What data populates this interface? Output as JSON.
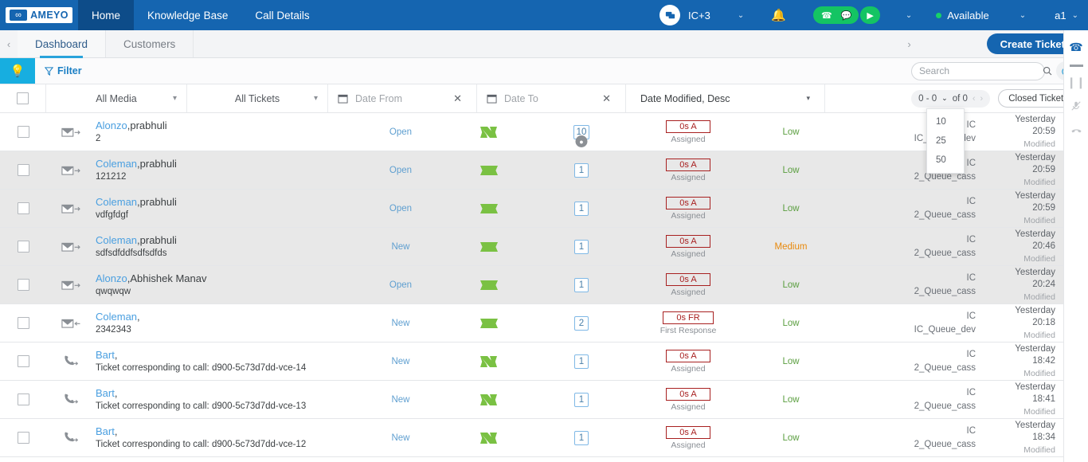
{
  "topnav": {
    "brand": "AMEYO",
    "brand_icon": "infinity-icon",
    "items": [
      {
        "label": "Home",
        "active": true
      },
      {
        "label": "Knowledge Base",
        "active": false
      },
      {
        "label": "Call Details",
        "active": false
      }
    ],
    "ic_label": "IC+3",
    "ic_icon": "chat-bubble-icon",
    "ic_chevron": "⌄",
    "bell_icon": "bell-icon",
    "phone_icon": "phone-icon",
    "chat_icon": "chat-icon",
    "video_icon": "video-icon",
    "channel_chevron": "⌄",
    "status_label": "Available",
    "status_color": "#17d268",
    "status_chevron": "⌄",
    "user_label": "a1",
    "user_chevron": "⌄"
  },
  "tabstrip": {
    "prev_arrow": "‹",
    "next_arrow": "›",
    "tabs": [
      {
        "label": "Dashboard",
        "active": true
      },
      {
        "label": "Customers",
        "active": false
      }
    ],
    "create_ticket_label": "Create Ticket"
  },
  "filterbar": {
    "bulb_icon": "lightbulb-icon",
    "filter_icon": "funnel-icon",
    "filter_label": "Filter",
    "search_placeholder": "Search",
    "search_value": "",
    "search_icon": "search-icon",
    "refresh_icon": "refresh-icon"
  },
  "toolbar": {
    "select_all_checked": false,
    "media_filter": "All Media",
    "tickets_filter": "All Tickets",
    "date_from_placeholder": "Date From",
    "date_from_value": "",
    "date_to_placeholder": "Date To",
    "date_to_value": "",
    "clear_icon": "close-icon",
    "calendar_icon": "calendar-icon",
    "sort_label": "Date Modified, Desc",
    "sort_caret": "▾",
    "pager_range": "0 - 0",
    "pager_caret": "⌄",
    "pager_of": "of 0",
    "pager_prev": "‹",
    "pager_next": "›",
    "closed_tickets_label": "Closed Tickets"
  },
  "page_size_menu": {
    "open": true,
    "options": [
      "10",
      "25",
      "50"
    ]
  },
  "table": {
    "rows": [
      {
        "channel_icon": "email-outbound-icon",
        "customer_first": "Alonzo",
        "customer_rest": ",prabhuli",
        "subject": "2",
        "status": "Open",
        "tag_icon": "tag-split-icon",
        "count": "10",
        "attachment_icon": "pdf-icon",
        "has_attachment": true,
        "sla_badge": "0s A",
        "sla_sub": "Assigned",
        "priority": "Low",
        "priority_level": "low",
        "queue_line1": "IC",
        "queue_line2": "IC_Queue_dev",
        "time_day": "Yesterday",
        "time_clock": "20:59",
        "time_label": "Modified",
        "shaded": false
      },
      {
        "channel_icon": "email-outbound-icon",
        "customer_first": "Coleman",
        "customer_rest": ",prabhuli",
        "subject": "121212",
        "status": "Open",
        "tag_icon": "tag-icon",
        "count": "1",
        "has_attachment": false,
        "sla_badge": "0s A",
        "sla_sub": "Assigned",
        "priority": "Low",
        "priority_level": "low",
        "queue_line1": "IC",
        "queue_line2": "2_Queue_cass",
        "time_day": "Yesterday",
        "time_clock": "20:59",
        "time_label": "Modified",
        "shaded": true
      },
      {
        "channel_icon": "email-outbound-icon",
        "customer_first": "Coleman",
        "customer_rest": ",prabhuli",
        "subject": "vdfgfdgf",
        "status": "Open",
        "tag_icon": "tag-icon",
        "count": "1",
        "has_attachment": false,
        "sla_badge": "0s A",
        "sla_sub": "Assigned",
        "priority": "Low",
        "priority_level": "low",
        "queue_line1": "IC",
        "queue_line2": "2_Queue_cass",
        "time_day": "Yesterday",
        "time_clock": "20:59",
        "time_label": "Modified",
        "shaded": true
      },
      {
        "channel_icon": "email-outbound-icon",
        "customer_first": "Coleman",
        "customer_rest": ",prabhuli",
        "subject": "sdfsdfddfsdfsdfds",
        "status": "New",
        "tag_icon": "tag-icon",
        "count": "1",
        "has_attachment": false,
        "sla_badge": "0s A",
        "sla_sub": "Assigned",
        "priority": "Medium",
        "priority_level": "medium",
        "queue_line1": "IC",
        "queue_line2": "2_Queue_cass",
        "time_day": "Yesterday",
        "time_clock": "20:46",
        "time_label": "Modified",
        "shaded": true
      },
      {
        "channel_icon": "email-outbound-icon",
        "customer_first": "Alonzo",
        "customer_rest": ",Abhishek Manav",
        "subject": "qwqwqw",
        "status": "Open",
        "tag_icon": "tag-icon",
        "count": "1",
        "has_attachment": false,
        "sla_badge": "0s A",
        "sla_sub": "Assigned",
        "priority": "Low",
        "priority_level": "low",
        "queue_line1": "IC",
        "queue_line2": "2_Queue_cass",
        "time_day": "Yesterday",
        "time_clock": "20:24",
        "time_label": "Modified",
        "shaded": true
      },
      {
        "channel_icon": "email-inbound-icon",
        "customer_first": "Coleman",
        "customer_rest": ",",
        "subject": "2342343",
        "status": "New",
        "tag_icon": "tag-icon",
        "count": "2",
        "has_attachment": false,
        "sla_badge": "0s FR",
        "sla_sub": "First Response",
        "priority": "Low",
        "priority_level": "low",
        "queue_line1": "IC",
        "queue_line2": "IC_Queue_dev",
        "time_day": "Yesterday",
        "time_clock": "20:18",
        "time_label": "Modified",
        "shaded": false
      },
      {
        "channel_icon": "call-outbound-icon",
        "customer_first": "Bart",
        "customer_rest": ",",
        "subject": "Ticket corresponding to call: d900-5c73d7dd-vce-14",
        "status": "New",
        "tag_icon": "tag-split-icon",
        "count": "1",
        "has_attachment": false,
        "sla_badge": "0s A",
        "sla_sub": "Assigned",
        "priority": "Low",
        "priority_level": "low",
        "queue_line1": "IC",
        "queue_line2": "2_Queue_cass",
        "time_day": "Yesterday",
        "time_clock": "18:42",
        "time_label": "Modified",
        "shaded": false
      },
      {
        "channel_icon": "call-outbound-icon",
        "customer_first": "Bart",
        "customer_rest": ",",
        "subject": "Ticket corresponding to call: d900-5c73d7dd-vce-13",
        "status": "New",
        "tag_icon": "tag-split-icon",
        "count": "1",
        "has_attachment": false,
        "sla_badge": "0s A",
        "sla_sub": "Assigned",
        "priority": "Low",
        "priority_level": "low",
        "queue_line1": "IC",
        "queue_line2": "2_Queue_cass",
        "time_day": "Yesterday",
        "time_clock": "18:41",
        "time_label": "Modified",
        "shaded": false
      },
      {
        "channel_icon": "call-outbound-icon",
        "customer_first": "Bart",
        "customer_rest": ",",
        "subject": "Ticket corresponding to call: d900-5c73d7dd-vce-12",
        "status": "New",
        "tag_icon": "tag-split-icon",
        "count": "1",
        "has_attachment": false,
        "sla_badge": "0s A",
        "sla_sub": "Assigned",
        "priority": "Low",
        "priority_level": "low",
        "queue_line1": "IC",
        "queue_line2": "2_Queue_cass",
        "time_day": "Yesterday",
        "time_clock": "18:34",
        "time_label": "Modified",
        "shaded": false
      }
    ]
  },
  "rail": {
    "icons": [
      "phone-icon",
      "pause-icon",
      "mute-icon",
      "hangup-icon"
    ]
  },
  "colors": {
    "brand_blue": "#1565b0",
    "nav_active": "#0d4c89",
    "accent_cyan": "#17aee0",
    "green": "#14c463",
    "tag_green": "#7ac143",
    "sla_red": "#a82020",
    "priority_low": "#5a9e3f",
    "priority_medium": "#e8890c",
    "link_blue": "#4a9fe0"
  }
}
